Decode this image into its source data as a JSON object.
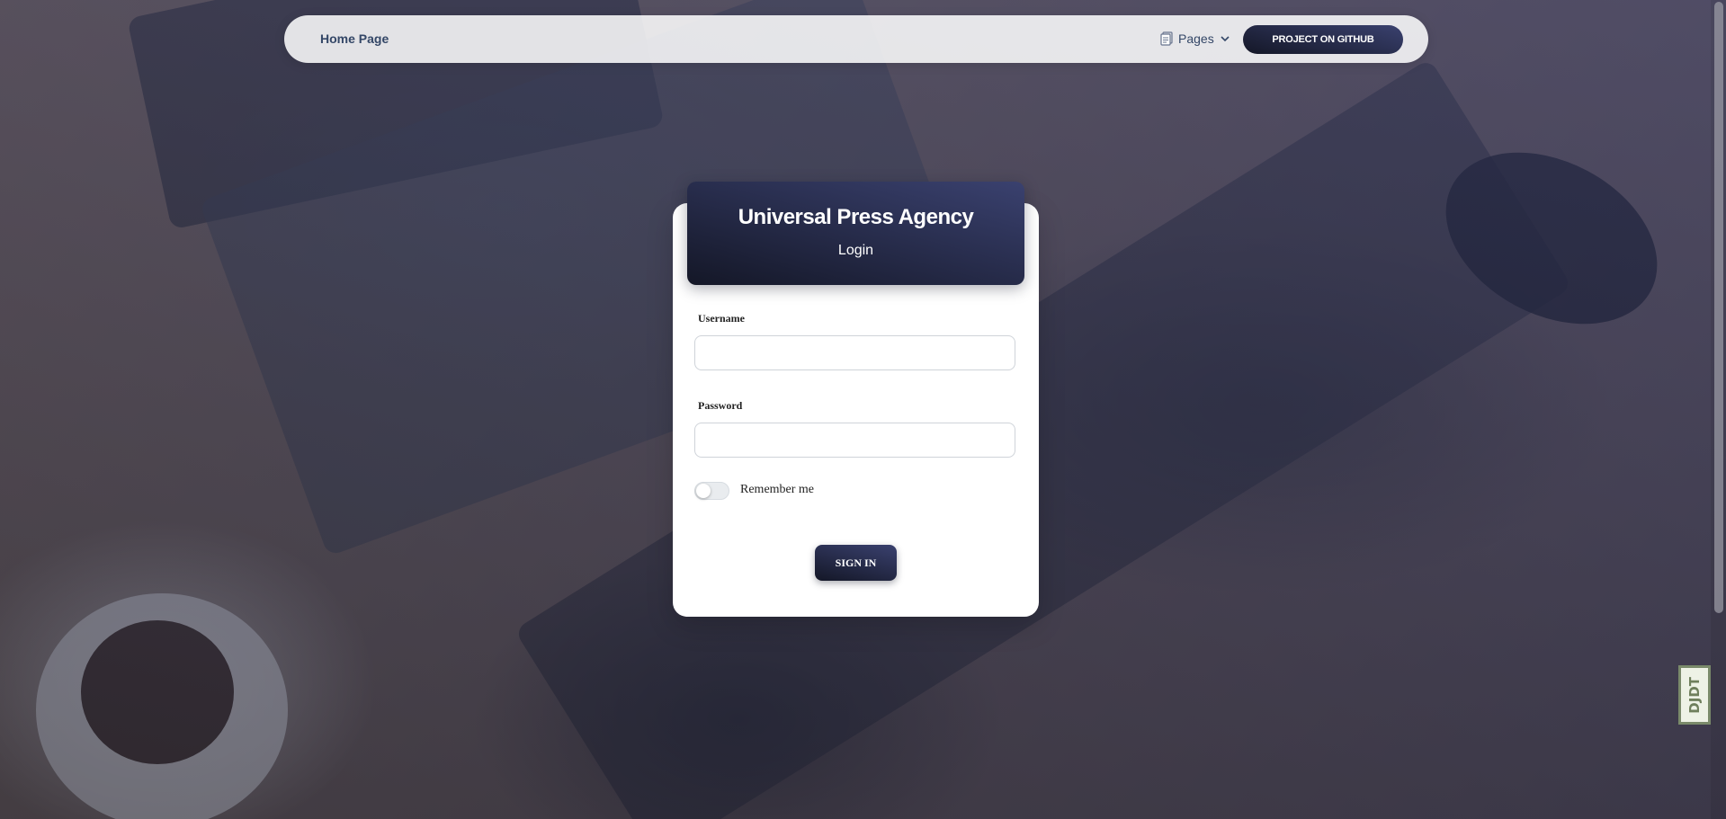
{
  "navbar": {
    "brand": "Home Page",
    "pages_label": "Pages",
    "pages_icon": "document-stack-icon",
    "github_button": "PROJECT ON GITHUB"
  },
  "login": {
    "title": "Universal Press Agency",
    "subtitle": "Login",
    "username_label": "Username",
    "username_value": "",
    "password_label": "Password",
    "password_value": "",
    "remember_label": "Remember me",
    "remember_checked": false,
    "submit_label": "SIGN IN"
  },
  "debug_toolbar": {
    "label": "DJDT"
  },
  "colors": {
    "primary_gradient_start": "#3a416f",
    "primary_gradient_end": "#141727",
    "nav_text": "#344767"
  }
}
